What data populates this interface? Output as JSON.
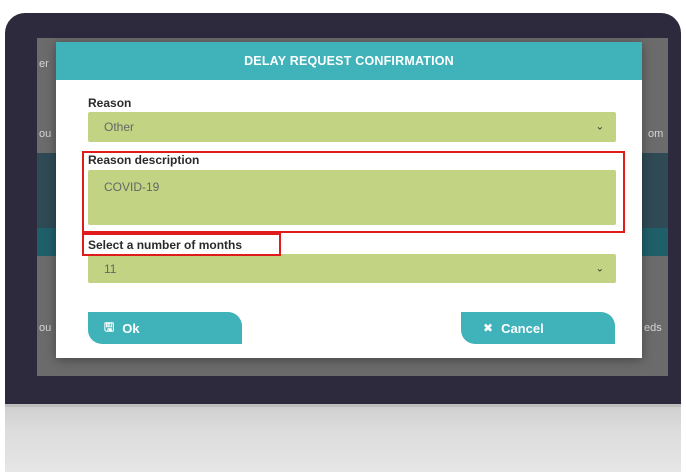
{
  "dialog": {
    "title": "DELAY REQUEST CONFIRMATION",
    "reason": {
      "label": "Reason",
      "value": "Other"
    },
    "reason_description": {
      "label": "Reason description",
      "value": "COVID-19"
    },
    "months": {
      "label": "Select a number of months",
      "value": "11"
    },
    "buttons": {
      "ok": "Ok",
      "cancel": "Cancel"
    }
  },
  "background": {
    "fragments": [
      "er",
      "ou",
      "om",
      "ou",
      "eds"
    ]
  },
  "icons": {
    "dropdown": "chevron-down-icon",
    "ok": "save-icon",
    "cancel": "close-icon"
  },
  "colors": {
    "accent": "#3fb3b9",
    "field": "#c2d483",
    "highlight": "#e01b1b",
    "frame": "#2e2a3e"
  }
}
